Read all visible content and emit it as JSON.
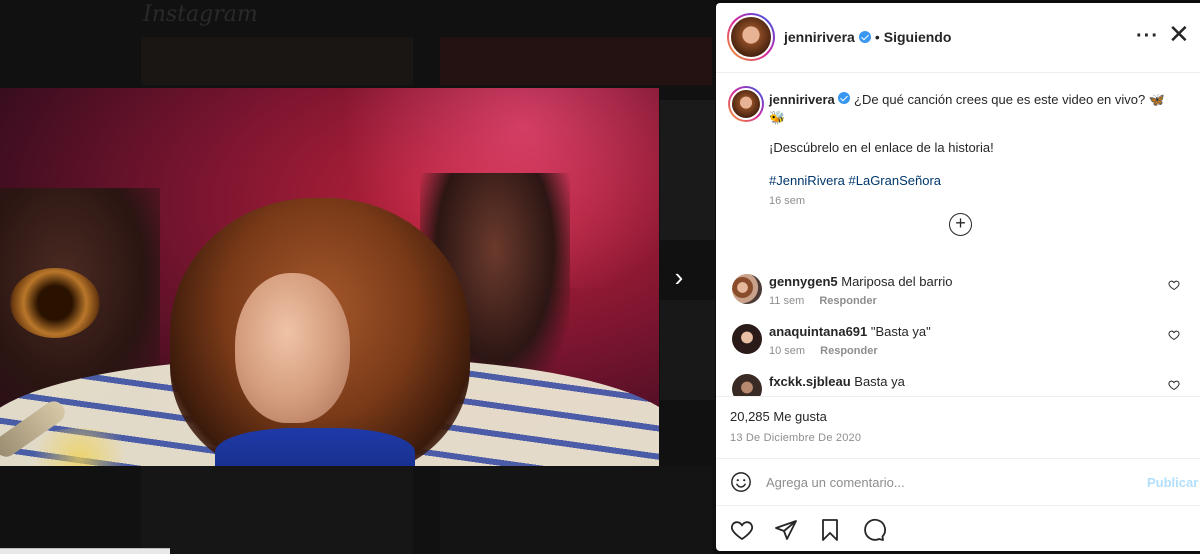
{
  "background": {
    "logo": "Instagram"
  },
  "post": {
    "username": "jennirivera",
    "separator": "•",
    "follow_status": "Siguiendo",
    "more_icon": "more-horizontal-icon",
    "close_icon": "close-icon",
    "next_icon": "chevron-right-icon"
  },
  "caption": {
    "username": "jennirivera",
    "text": "¿De qué canción crees que es este video en vivo? 🦋🐝",
    "line2": "¡Descúbrelo en el enlace de la historia!",
    "hashtags": [
      "#JenniRivera",
      "#LaGranSeñora"
    ],
    "time": "16 sem",
    "load_more_icon": "plus-circle-icon"
  },
  "comments": [
    {
      "username": "gennygen5",
      "text": "Mariposa del barrio",
      "time": "11 sem",
      "reply": "Responder"
    },
    {
      "username": "anaquintana691",
      "text": "\"Basta ya\"",
      "time": "10 sem",
      "reply": "Responder"
    },
    {
      "username": "fxckk.sjbleau",
      "text": "Basta ya",
      "time": "",
      "reply": ""
    }
  ],
  "stats": {
    "likes": "20,285 Me gusta",
    "date": "13 De Diciembre De 2020"
  },
  "comment_box": {
    "placeholder": "Agrega un comentario...",
    "publish": "Publicar"
  },
  "colors": {
    "verified": "#3897f0",
    "link": "#00376b",
    "publish_disabled": "#b2dffc",
    "muted": "#8e8e8e"
  }
}
